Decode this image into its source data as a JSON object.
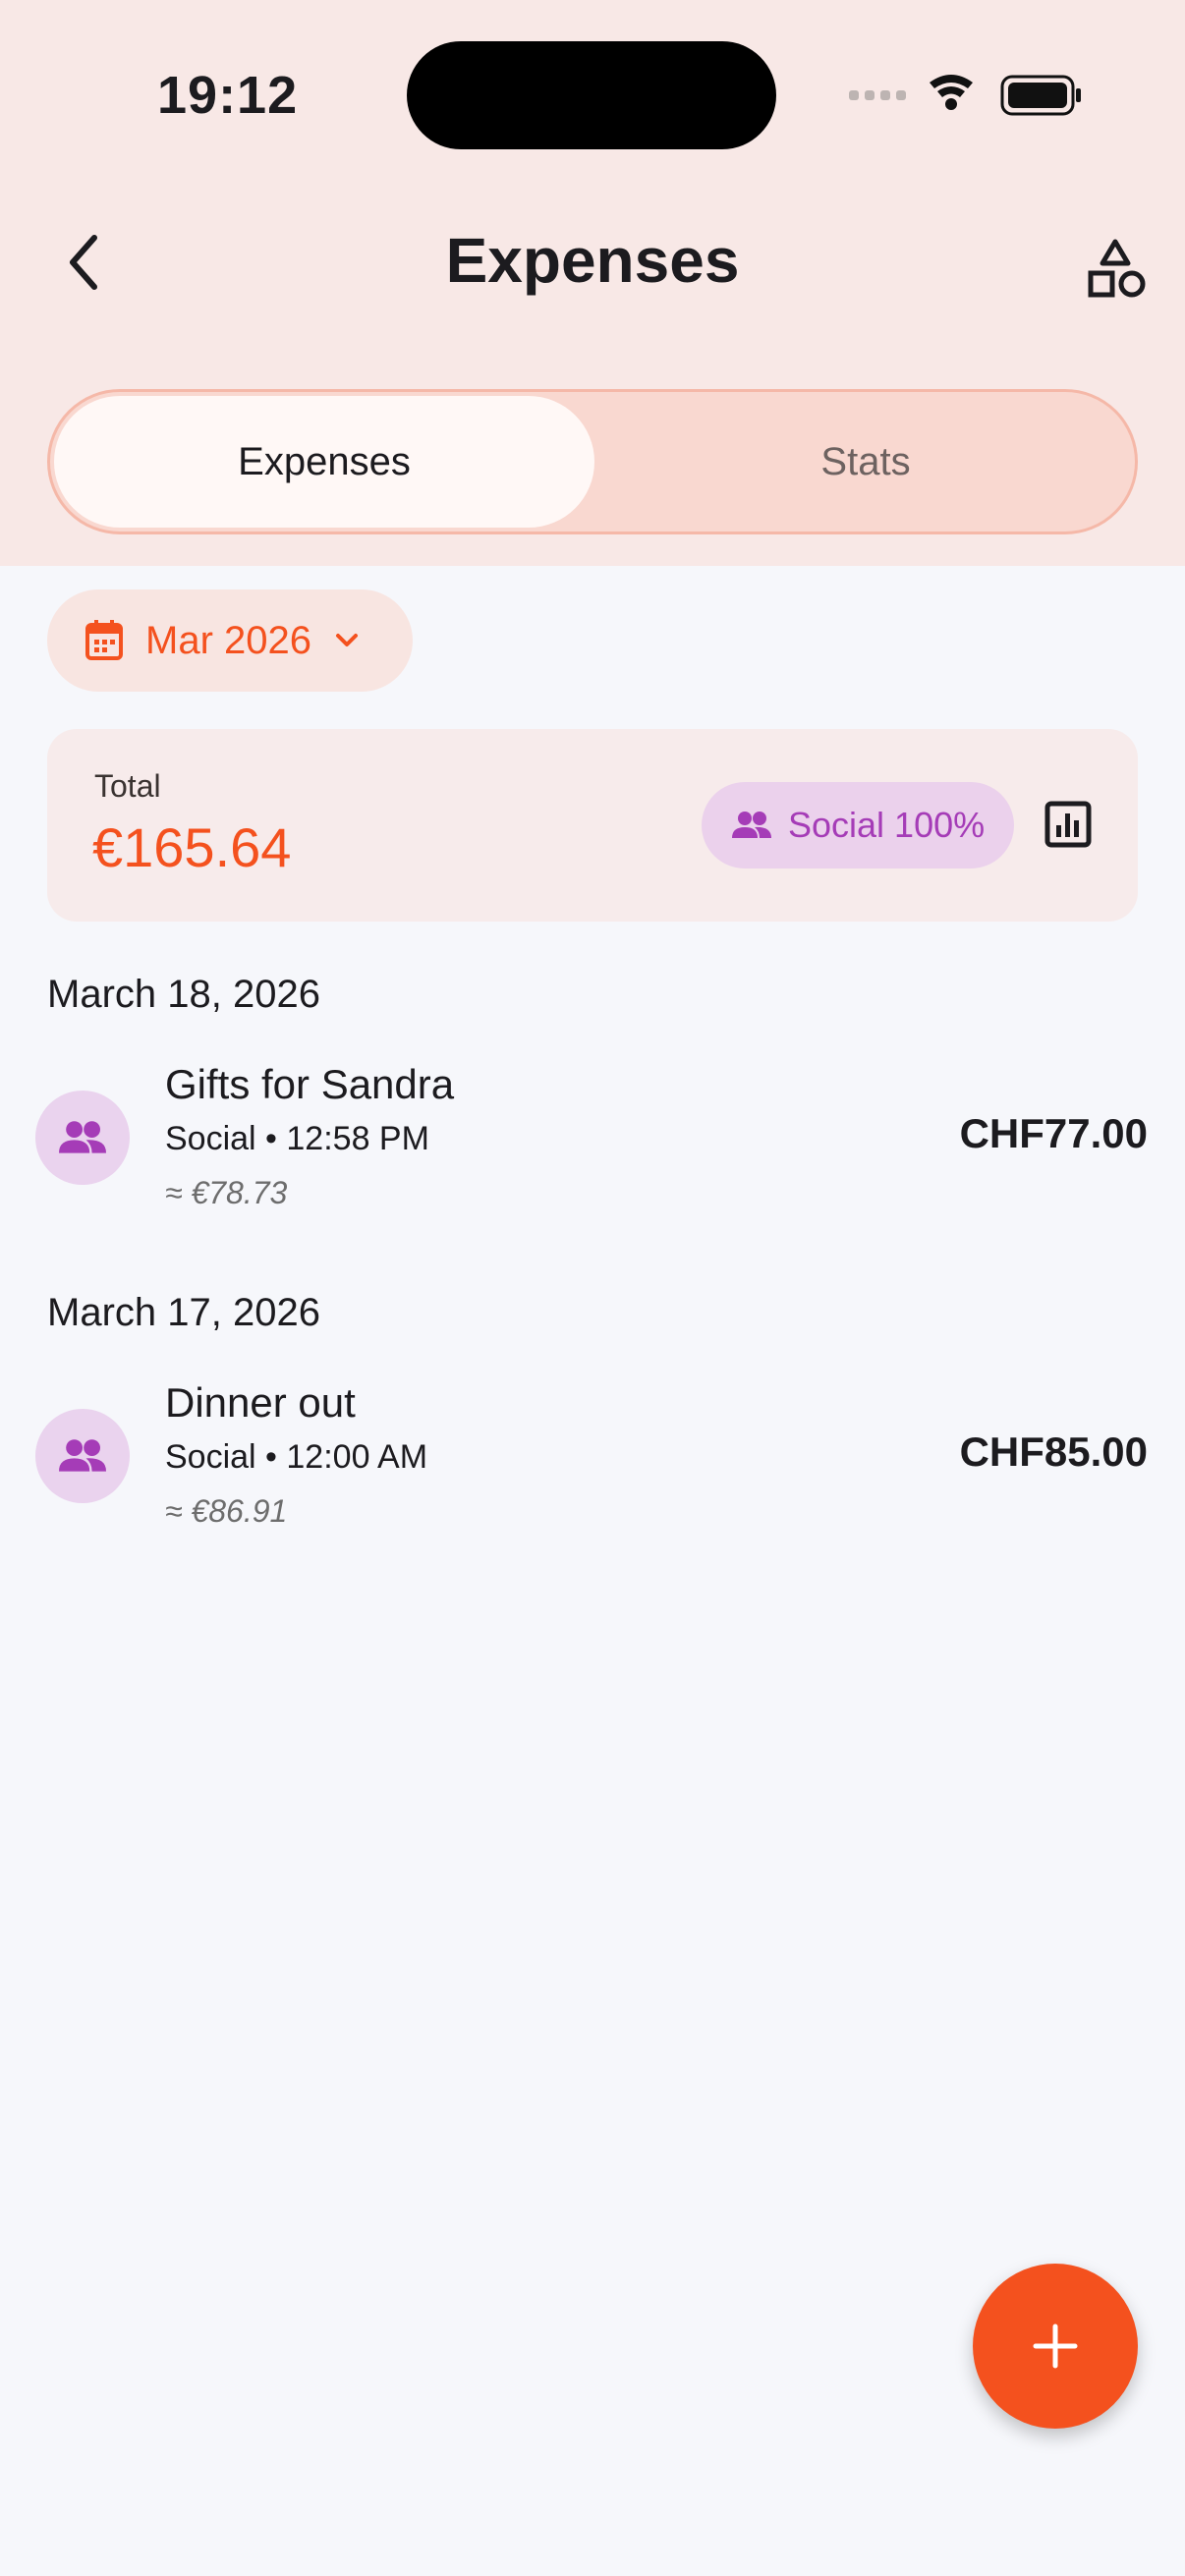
{
  "status_bar": {
    "time": "19:12"
  },
  "header": {
    "title": "Expenses"
  },
  "tabs": [
    {
      "label": "Expenses",
      "active": true
    },
    {
      "label": "Stats",
      "active": false
    }
  ],
  "month_filter": {
    "label": "Mar 2026"
  },
  "summary": {
    "total_label": "Total",
    "total_value": "€165.64",
    "category_pill": "Social 100%"
  },
  "groups": [
    {
      "date": "March 18, 2026",
      "items": [
        {
          "name": "Gifts for Sandra",
          "meta": "Social • 12:58 PM",
          "converted": "≈ €78.73",
          "amount": "CHF77.00",
          "icon": "people-icon"
        }
      ]
    },
    {
      "date": "March 17, 2026",
      "items": [
        {
          "name": "Dinner out",
          "meta": "Social • 12:00 AM",
          "converted": "≈ €86.91",
          "amount": "CHF85.00",
          "icon": "people-icon"
        }
      ]
    }
  ],
  "colors": {
    "accent": "#f4511e",
    "header_bg": "#f8e8e6",
    "social_purple": "#a53cb7",
    "social_bg": "#ead3ee"
  }
}
